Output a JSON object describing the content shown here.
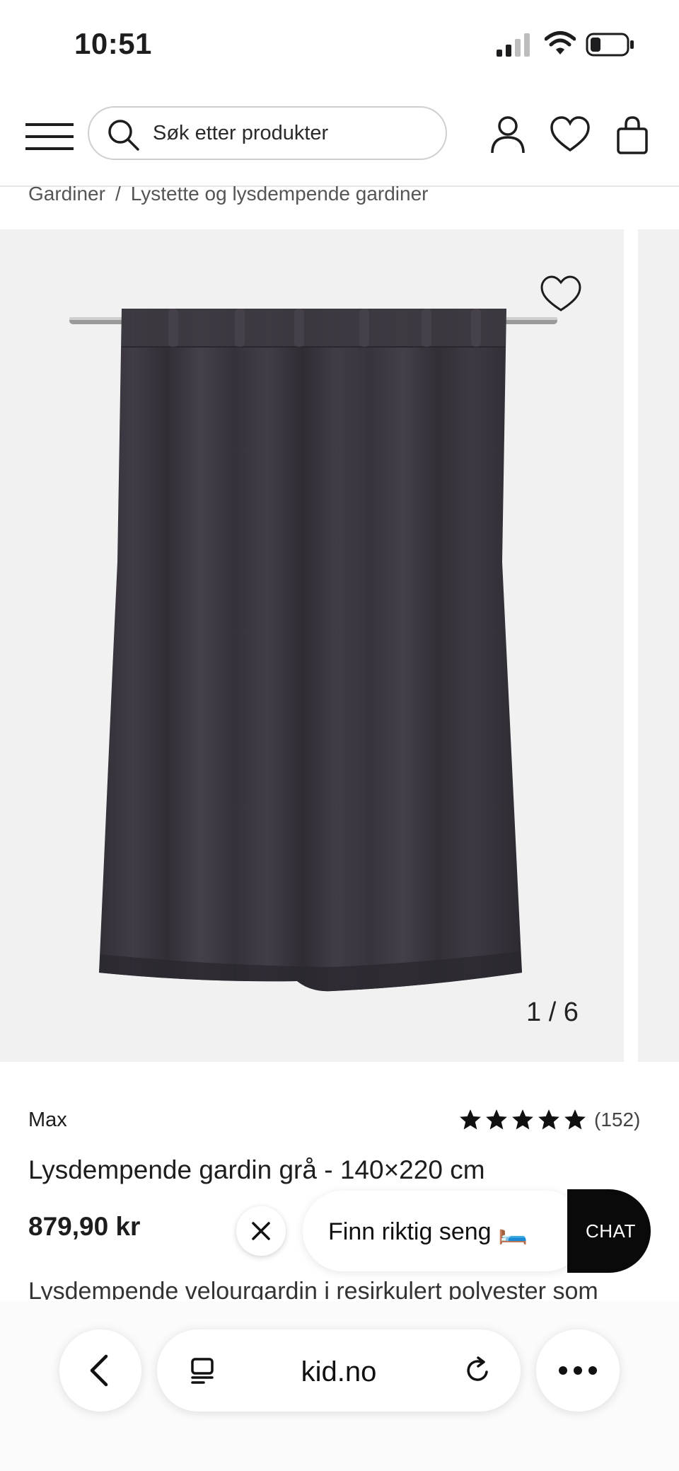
{
  "status_bar": {
    "time": "10:51"
  },
  "header": {
    "search_placeholder": "Søk etter produkter"
  },
  "breadcrumb": {
    "items": [
      "Gardiner",
      "Lystette og lysdempende gardiner"
    ],
    "separator": "/"
  },
  "gallery": {
    "counter": "1 / 6"
  },
  "product": {
    "brand": "Max",
    "rating_count": "(152)",
    "stars": 5,
    "title": "Lysdempende gardin grå - 140×220 cm",
    "price": "879,90 kr",
    "description": "Lysdempende velourgardin i resirkulert polyester som"
  },
  "promo": {
    "text": "Finn riktig seng 🛏️",
    "chat_label": "CHAT"
  },
  "browser": {
    "url": "kid.no"
  },
  "colors": {
    "curtain": "#3a363f",
    "accent": "#0a0a0a",
    "gallery_bg": "#f1f1f1"
  }
}
